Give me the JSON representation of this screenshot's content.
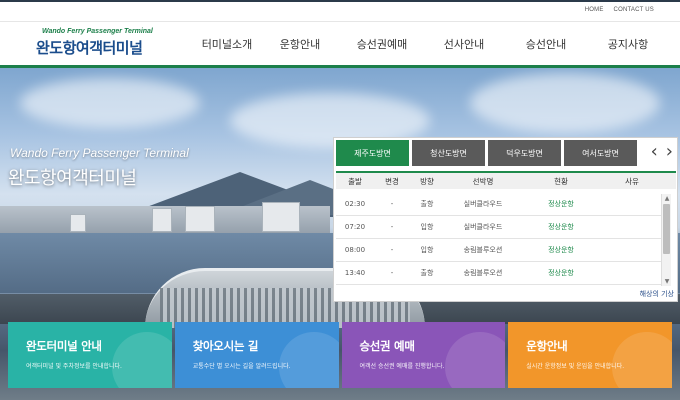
{
  "toplinks": {
    "home": "HOME",
    "contact": "CONTACT US"
  },
  "logo": {
    "en": "Wando Ferry Passenger Terminal",
    "ko": "완도항여객터미널"
  },
  "nav": [
    "터미널소개",
    "운항안내",
    "승선권예매",
    "선사안내",
    "승선안내",
    "공지사항"
  ],
  "hero": {
    "en": "Wando Ferry Passenger Terminal",
    "ko": "완도항여객터미널"
  },
  "schedule": {
    "tabs": [
      "제주도방면",
      "청산도방면",
      "덕우도방면",
      "여서도방면"
    ],
    "active_tab": 0,
    "prev_icon": "chevron-left-icon",
    "next_icon": "chevron-right-icon",
    "headers": [
      "출발",
      "변경",
      "방향",
      "선박명",
      "현황",
      "사유"
    ],
    "rows": [
      [
        "02:30",
        "-",
        "출항",
        "실버클라우드",
        "정상운항",
        ""
      ],
      [
        "07:20",
        "-",
        "입항",
        "실버클라우드",
        "정상운항",
        ""
      ],
      [
        "08:00",
        "-",
        "입항",
        "송림블루오션",
        "정상운항",
        ""
      ],
      [
        "13:40",
        "-",
        "출항",
        "송림블루오션",
        "정상운항",
        ""
      ]
    ],
    "more_link": "해상의 기상"
  },
  "cards": [
    {
      "title": "완도터미널 안내",
      "sub": "여객터미널 및 주차정보를 안내합니다.",
      "color": "#29b3a6"
    },
    {
      "title": "찾아오시는 길",
      "sub": "교통수단 별 오시는 길을 알려드립니다.",
      "color": "#3d8fd6"
    },
    {
      "title": "승선권 예매",
      "sub": "여객선 승선권 예매를 진행합니다.",
      "color": "#8a55b8"
    },
    {
      "title": "운항안내",
      "sub": "실시간 운항정보 및 운임을 안내합니다.",
      "color": "#f2962a"
    }
  ],
  "colors": {
    "brand_green": "#1f8a4c",
    "brand_navy": "#1b4d8c",
    "tab_inactive": "#5a5a5a"
  }
}
